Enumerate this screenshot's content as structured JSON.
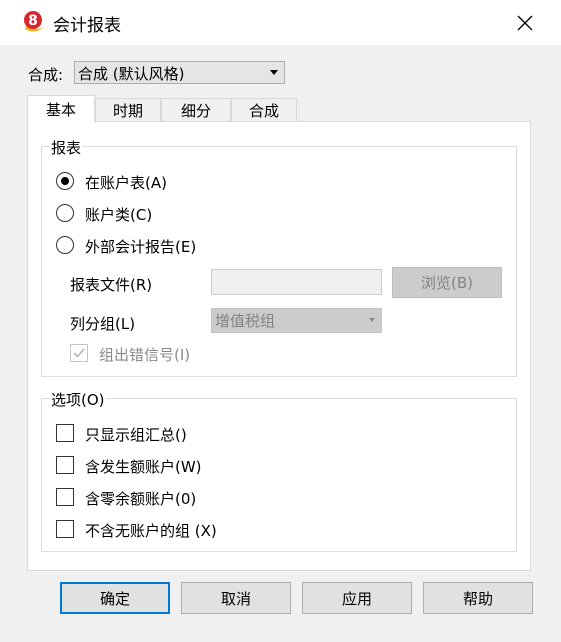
{
  "window": {
    "title": "会计报表",
    "app_icon": "app-logo-icon",
    "close_icon": "close-icon"
  },
  "header": {
    "combo_label": "合成:",
    "combo_value": "合成 (默认风格)"
  },
  "tabs": [
    {
      "label": "基本",
      "active": true
    },
    {
      "label": "时期",
      "active": false
    },
    {
      "label": "细分",
      "active": false
    },
    {
      "label": "合成",
      "active": false
    }
  ],
  "report_group": {
    "title": "报表",
    "options": [
      {
        "label": "在账户表(A)",
        "checked": true
      },
      {
        "label": "账户类(C)",
        "checked": false
      },
      {
        "label": "外部会计报告(E)",
        "checked": false
      }
    ],
    "file_label": "报表文件(R)",
    "file_value": "",
    "browse_label": "浏览(B)",
    "column_group_label": "列分组(L)",
    "column_group_value": "增值税组",
    "error_sign_label": "组出错信号(I)",
    "error_sign_checked": true
  },
  "options_group": {
    "title": "选项(O)",
    "items": [
      {
        "label": "只显示组汇总()",
        "checked": false
      },
      {
        "label": "含发生额账户(W)",
        "checked": false
      },
      {
        "label": "含零余额账户(0)",
        "checked": false
      },
      {
        "label": "不含无账户的组 (X)",
        "checked": false
      }
    ]
  },
  "buttons": {
    "ok": "确定",
    "cancel": "取消",
    "apply": "应用",
    "help": "帮助"
  },
  "colors": {
    "dialog_bg": "#f0f0f0",
    "default_button_border": "#0078d7"
  }
}
